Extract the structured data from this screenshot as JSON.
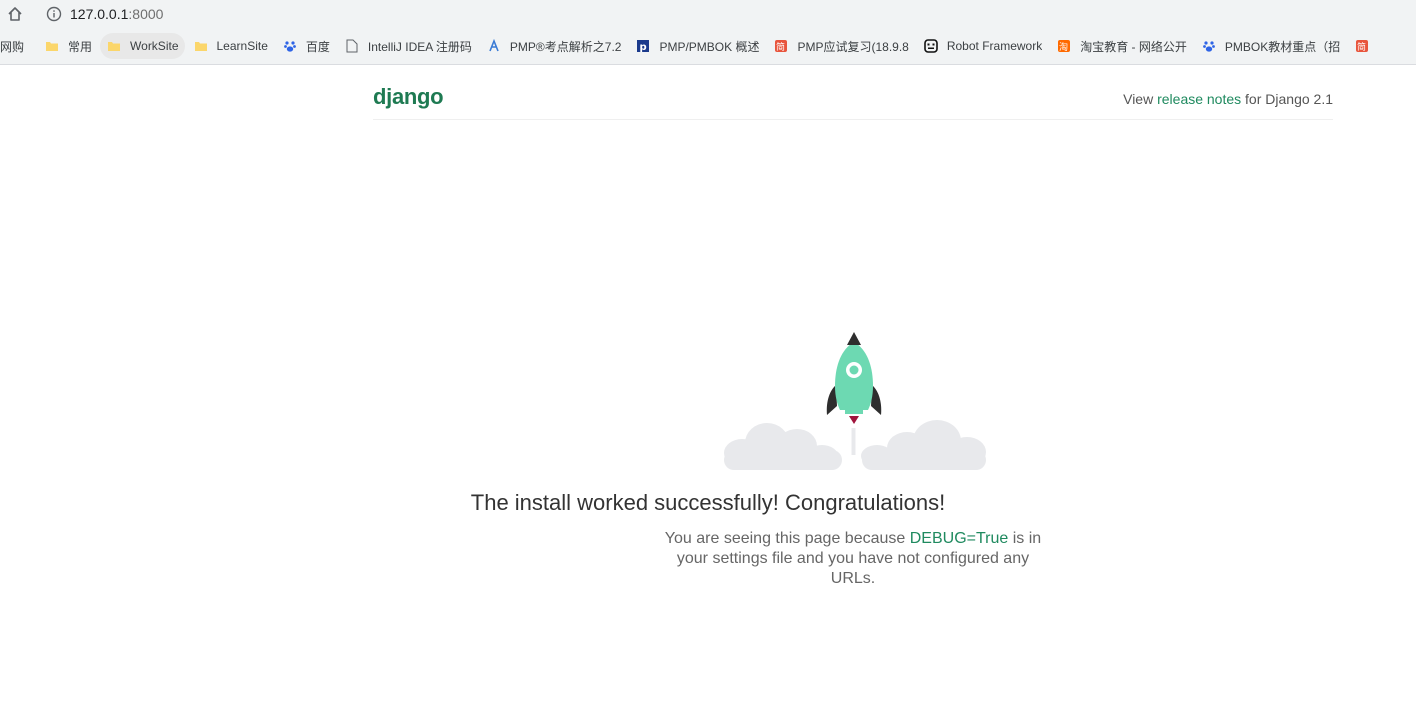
{
  "browser": {
    "url_host": "127.0.0.1",
    "url_port": ":8000",
    "bookmarks": [
      {
        "label": "网购",
        "icon": "none"
      },
      {
        "label": "常用",
        "icon": "folder-icon"
      },
      {
        "label": "WorkSite",
        "icon": "folder-icon"
      },
      {
        "label": "LearnSite",
        "icon": "folder-icon"
      },
      {
        "label": "百度",
        "icon": "baidu-paw-icon"
      },
      {
        "label": "IntelliJ IDEA 注册码",
        "icon": "page-icon"
      },
      {
        "label": "PMP®考点解析之7.2",
        "icon": "blue-leaf-icon"
      },
      {
        "label": "PMP/PMBOK 概述",
        "icon": "p-icon"
      },
      {
        "label": "PMP应试复习(18.9.8",
        "icon": "jianshu-icon"
      },
      {
        "label": "Robot Framework",
        "icon": "robot-icon"
      },
      {
        "label": "淘宝教育 - 网络公开",
        "icon": "taobao-icon"
      },
      {
        "label": "PMBOK教材重点（招",
        "icon": "baidu-paw-icon"
      },
      {
        "label": "",
        "icon": "jianshu-icon"
      }
    ]
  },
  "django": {
    "logo": "django",
    "release_prefix": "View ",
    "release_link": "release notes",
    "release_suffix": " for Django 2.1",
    "headline": "The install worked successfully! Congratulations!",
    "desc_prefix": "You are seeing this page because ",
    "desc_debug": "DEBUG=True",
    "desc_suffix": " is in your settings file and you have not configured any URLs."
  },
  "colors": {
    "django_green": "#1f8a5f",
    "rocket_body": "#6dd9b2",
    "rocket_fin": "#2e2e2e",
    "cloud": "#e8e9ec"
  }
}
